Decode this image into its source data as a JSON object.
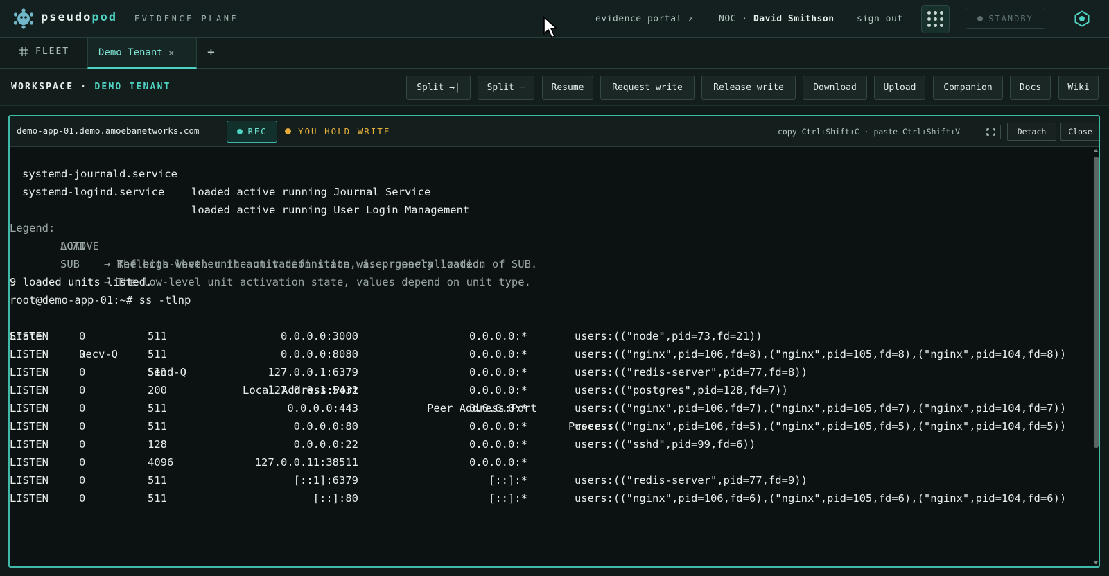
{
  "header": {
    "brand_pre": "pseudo",
    "brand_accent": "pod",
    "subtitle": "EVIDENCE PLANE",
    "portal_link": "evidence portal ↗",
    "role": "NOC ·",
    "user": "David Smithson",
    "sign_out": "sign out",
    "status": "STANDBY"
  },
  "tabs": {
    "fleet": "FLEET",
    "active": "Demo Tenant",
    "add": "+"
  },
  "workspace": {
    "label": "WORKSPACE",
    "separator": "·",
    "tenant": "DEMO TENANT",
    "buttons": {
      "split_right": "Split →|",
      "split_down": "Split ─",
      "resume": "Resume",
      "request_write": "Request write",
      "release_write": "Release write",
      "download": "Download",
      "upload": "Upload",
      "companion": "Companion",
      "docs": "Docs",
      "wiki": "Wiki"
    }
  },
  "session": {
    "host": "demo-app-01.demo.amoebanetworks.com",
    "rec": "REC",
    "write_status": "YOU HOLD WRITE",
    "hints": "copy Ctrl+Shift+C · paste Ctrl+Shift+V",
    "detach": "Detach",
    "close": "Close"
  },
  "terminal": {
    "units": [
      {
        "name": "systemd-journald.service",
        "state": "loaded active running Journal Service"
      },
      {
        "name": "systemd-logind.service",
        "state": "loaded active running User Login Management"
      }
    ],
    "legend": [
      {
        "prefix": "Legend: ",
        "key": "LOAD  ",
        "text": "→ Reflects whether the unit definition was properly loaded."
      },
      {
        "prefix": "        ",
        "key": "ACTIVE",
        "text": "→ The high-level unit activation state, i.e. generalization of SUB."
      },
      {
        "prefix": "        ",
        "key": "SUB   ",
        "text": "→ The low-level unit activation state, values depend on unit type."
      }
    ],
    "summary": "9 loaded units listed.",
    "prompt": "root@demo-app-01:~# ss -tlnp",
    "headers": {
      "state": "State",
      "recvq": "Recv-Q",
      "sendq": "Send-Q",
      "local": "Local Address:Port",
      "peer": "Peer Address:Port",
      "process": "Process"
    },
    "rows": [
      {
        "state": "LISTEN",
        "recvq": "0",
        "sendq": "511",
        "local": "0.0.0.0:3000",
        "peer": "0.0.0.0:*",
        "process": "users:((\"node\",pid=73,fd=21))"
      },
      {
        "state": "LISTEN",
        "recvq": "0",
        "sendq": "511",
        "local": "0.0.0.0:8080",
        "peer": "0.0.0.0:*",
        "process": "users:((\"nginx\",pid=106,fd=8),(\"nginx\",pid=105,fd=8),(\"nginx\",pid=104,fd=8))"
      },
      {
        "state": "LISTEN",
        "recvq": "0",
        "sendq": "511",
        "local": "127.0.0.1:6379",
        "peer": "0.0.0.0:*",
        "process": "users:((\"redis-server\",pid=77,fd=8))"
      },
      {
        "state": "LISTEN",
        "recvq": "0",
        "sendq": "200",
        "local": "127.0.0.1:5432",
        "peer": "0.0.0.0:*",
        "process": "users:((\"postgres\",pid=128,fd=7))"
      },
      {
        "state": "LISTEN",
        "recvq": "0",
        "sendq": "511",
        "local": "0.0.0.0:443",
        "peer": "0.0.0.0:*",
        "process": "users:((\"nginx\",pid=106,fd=7),(\"nginx\",pid=105,fd=7),(\"nginx\",pid=104,fd=7))"
      },
      {
        "state": "LISTEN",
        "recvq": "0",
        "sendq": "511",
        "local": "0.0.0.0:80",
        "peer": "0.0.0.0:*",
        "process": "users:((\"nginx\",pid=106,fd=5),(\"nginx\",pid=105,fd=5),(\"nginx\",pid=104,fd=5))"
      },
      {
        "state": "LISTEN",
        "recvq": "0",
        "sendq": "128",
        "local": "0.0.0.0:22",
        "peer": "0.0.0.0:*",
        "process": "users:((\"sshd\",pid=99,fd=6))"
      },
      {
        "state": "LISTEN",
        "recvq": "0",
        "sendq": "4096",
        "local": "127.0.0.11:38511",
        "peer": "0.0.0.0:*",
        "process": ""
      },
      {
        "state": "LISTEN",
        "recvq": "0",
        "sendq": "511",
        "local": "[::1]:6379",
        "peer": "[::]:*",
        "process": "users:((\"redis-server\",pid=77,fd=9))"
      },
      {
        "state": "LISTEN",
        "recvq": "0",
        "sendq": "511",
        "local": "[::]:80",
        "peer": "[::]:*",
        "process": "users:((\"nginx\",pid=106,fd=6),(\"nginx\",pid=105,fd=6),(\"nginx\",pid=104,fd=6))"
      }
    ]
  },
  "colors": {
    "accent": "#4fd2c2",
    "write_hold": "#e6a93a",
    "background": "#0f1a19"
  },
  "icons": [
    "pod-logo-icon",
    "cursor-icon",
    "apps-grid-icon",
    "status-dot-icon",
    "shield-icon",
    "fleet-hash-icon",
    "close-icon",
    "expand-icon"
  ]
}
